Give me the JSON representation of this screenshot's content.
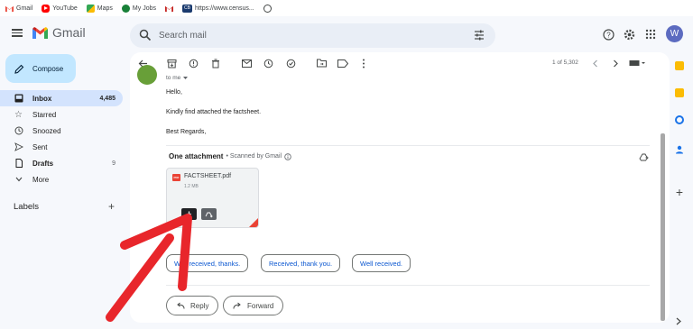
{
  "bookmarks": [
    {
      "label": "Gmail",
      "color": "#ea4335"
    },
    {
      "label": "YouTube",
      "color": "#ff0000"
    },
    {
      "label": "Maps",
      "color": "#34a853"
    },
    {
      "label": "My Jobs",
      "color": "#188038"
    },
    {
      "label": "",
      "color": "#c5221f"
    },
    {
      "label": "https://www.census...",
      "color": "#1a3a6e",
      "badge": "CB"
    },
    {
      "label": "",
      "color": "#444746"
    }
  ],
  "header": {
    "app_name": "Gmail",
    "search_placeholder": "Search mail",
    "avatar_letter": "W"
  },
  "sidebar": {
    "compose_label": "Compose",
    "items": [
      {
        "label": "Inbox",
        "count": "4,485",
        "icon": "inbox-icon"
      },
      {
        "label": "Starred",
        "count": "",
        "icon": "star-icon"
      },
      {
        "label": "Snoozed",
        "count": "",
        "icon": "clock-icon"
      },
      {
        "label": "Sent",
        "count": "",
        "icon": "send-icon"
      },
      {
        "label": "Drafts",
        "count": "9",
        "icon": "draft-icon"
      },
      {
        "label": "More",
        "count": "",
        "icon": "chevron-down-icon"
      }
    ],
    "labels_title": "Labels",
    "labels_add": "+"
  },
  "toolbar": {
    "pager": "1 of 5,302"
  },
  "message": {
    "to_line": "to me",
    "lines": [
      "Hello,",
      "Kindly find attached the factsheet.",
      "Best Regards,"
    ]
  },
  "attachments": {
    "title": "One attachment",
    "scanned": "• Scanned by Gmail",
    "file_name": "FACTSHEET.pdf",
    "file_size": "1.2 MB",
    "file_type": "PDF"
  },
  "smart_replies": [
    "Well received, thanks.",
    "Received, thank you.",
    "Well received."
  ],
  "actions": {
    "reply": "Reply",
    "forward": "Forward"
  },
  "colors": {
    "accent": "#0b57d0",
    "compose_bg": "#c2e7ff",
    "active_nav": "#d3e3fd",
    "annotation_arrow": "#e8262b"
  }
}
